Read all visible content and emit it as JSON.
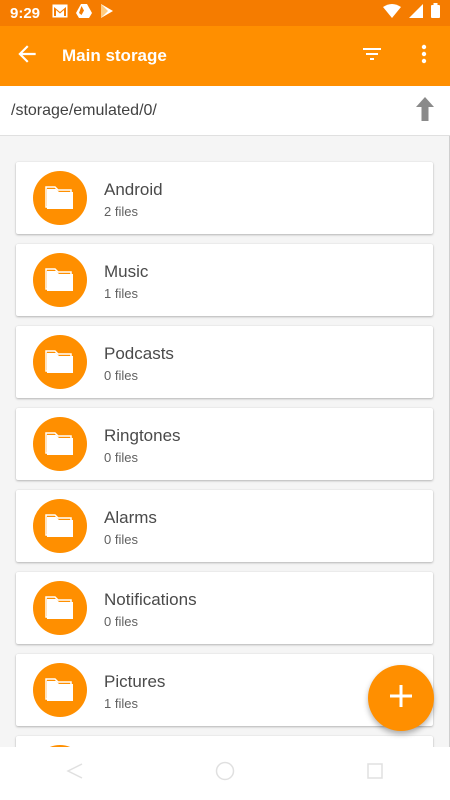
{
  "status_bar": {
    "time": "9:29",
    "left_icons": [
      "gmail-icon",
      "drive-icon",
      "play-store-icon"
    ],
    "right_icons": [
      "wifi-icon",
      "signal-icon",
      "battery-icon"
    ]
  },
  "app_bar": {
    "title": "Main storage",
    "back_icon": "arrow-left-icon",
    "filter_icon": "sort-filter-icon",
    "menu_icon": "more-vert-icon"
  },
  "path_bar": {
    "path": "/storage/emulated/0/",
    "up_icon": "arrow-up-icon"
  },
  "folders": [
    {
      "name": "Android",
      "count": "2 files"
    },
    {
      "name": "Music",
      "count": "1 files"
    },
    {
      "name": "Podcasts",
      "count": "0 files"
    },
    {
      "name": "Ringtones",
      "count": "0 files"
    },
    {
      "name": "Alarms",
      "count": "0 files"
    },
    {
      "name": "Notifications",
      "count": "0 files"
    },
    {
      "name": "Pictures",
      "count": "1 files"
    },
    {
      "name": "",
      "count": ""
    }
  ],
  "fab": {
    "icon": "plus-icon"
  },
  "colors": {
    "status_bar": "#f57c00",
    "accent": "#ff8f00",
    "list_background": "#f5f5f5"
  }
}
